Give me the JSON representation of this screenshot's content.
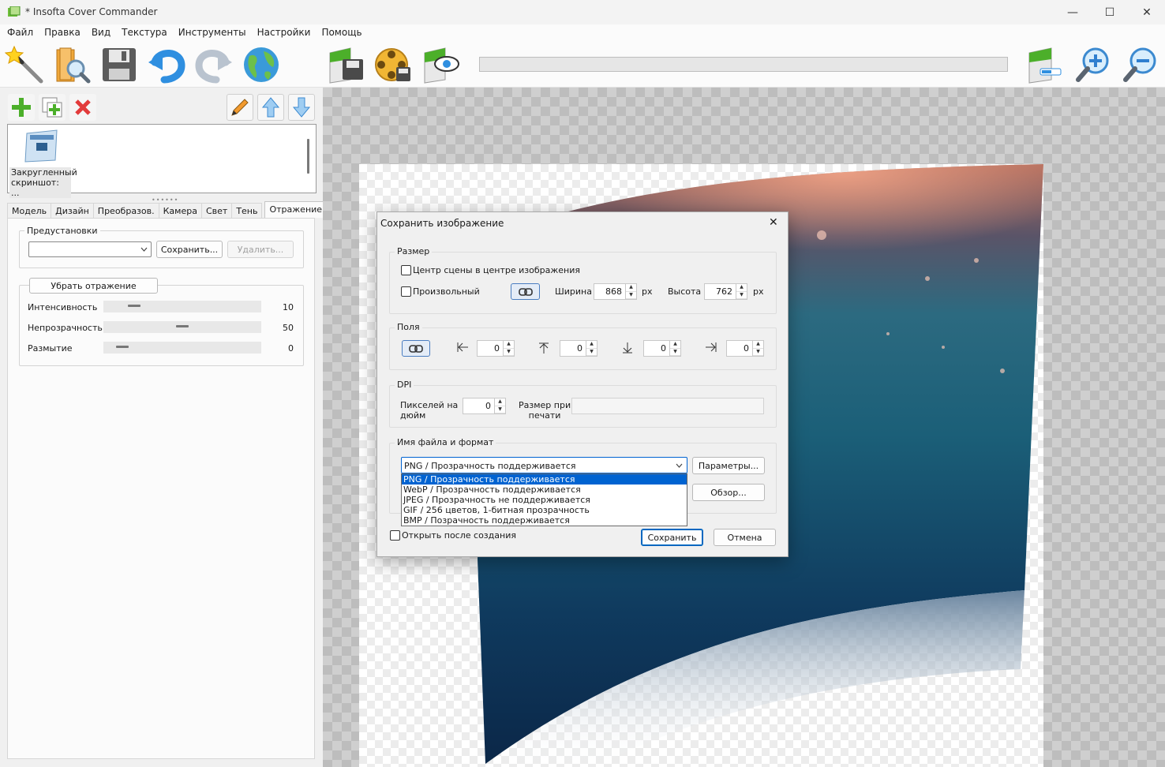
{
  "window": {
    "title": "* Insofta Cover Commander",
    "minimize": "—",
    "maximize": "☐",
    "close": "✕"
  },
  "menu": [
    "Файл",
    "Правка",
    "Вид",
    "Текстура",
    "Инструменты",
    "Настройки",
    "Помощь"
  ],
  "model_list": {
    "item_caption": "Закругленный скриншот: ..."
  },
  "tabs": [
    "Модель",
    "Дизайн",
    "Преобразов.",
    "Камера",
    "Свет",
    "Тень",
    "Отражение"
  ],
  "active_tab": "Отражение",
  "presets": {
    "legend": "Предустановки",
    "selected": "",
    "save_label": "Сохранить...",
    "delete_label": "Удалить..."
  },
  "reflection": {
    "remove_label": "Убрать отражение",
    "sliders": [
      {
        "label": "Интенсивность",
        "value": "10",
        "fraction": 0.1
      },
      {
        "label": "Непрозрачность",
        "value": "50",
        "fraction": 0.5
      },
      {
        "label": "Размытие",
        "value": "0",
        "fraction": 0.0
      }
    ]
  },
  "dialog": {
    "title": "Сохранить изображение",
    "close": "✕",
    "size": {
      "legend": "Размер",
      "center_label": "Центр сцены в центре изображения",
      "custom_label": "Произвольный",
      "width_label": "Ширина",
      "width_value": "868",
      "width_unit": "px",
      "height_label": "Высота",
      "height_value": "762",
      "height_unit": "px"
    },
    "margins": {
      "legend": "Поля",
      "left": "0",
      "top": "0",
      "bottom": "0",
      "right": "0"
    },
    "dpi": {
      "legend": "DPI",
      "ppi_label_1": "Пикселей на",
      "ppi_label_2": "дюйм",
      "ppi_value": "0",
      "print_label_1": "Размер при",
      "print_label_2": "печати",
      "print_value": ""
    },
    "file": {
      "legend": "Имя файла и формат",
      "format_selected": "PNG / Прозрачность поддерживается",
      "params_label": "Параметры...",
      "browse_label": "Обзор...",
      "options": [
        "PNG / Прозрачность поддерживается",
        "WebP / Прозрачность поддерживается",
        "JPEG / Прозрачность не поддерживается",
        "GIF / 256 цветов, 1-битная прозрачность",
        "BMP / Позрачность поддерживается"
      ]
    },
    "open_after_label": "Открыть после создания",
    "save_label": "Сохранить",
    "cancel_label": "Отмена"
  },
  "colors": {
    "accent": "#0063d1",
    "toolbar_green": "#4caf2a",
    "arrow_blue": "#2f8fe0",
    "delete_red": "#e23b3b"
  }
}
